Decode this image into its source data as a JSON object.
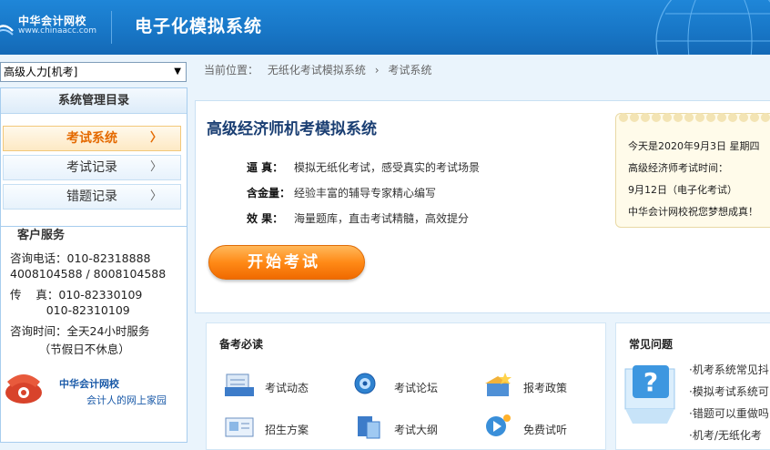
{
  "header": {
    "logo_cn": "中华会计网校",
    "logo_en": "www.chinaacc.com",
    "title": "电子化模拟系统"
  },
  "sidebar": {
    "exam_select": "高级人力[机考]",
    "menu_title": "系统管理目录",
    "items": [
      {
        "label": "考试系统",
        "active": true
      },
      {
        "label": "考试记录",
        "active": false
      },
      {
        "label": "错题记录",
        "active": false
      }
    ],
    "service": {
      "title": "客户服务",
      "lines": [
        "咨询电话：010-82318888",
        "4008104588 / 8008104588",
        "传    真：010-82330109",
        "          010-82310109",
        "咨询时间：全天24小时服务",
        "        （节假日不休息）"
      ],
      "brand": "中华会计网校",
      "slogan": "会计人的网上家园"
    }
  },
  "breadcrumb": {
    "prefix": "当前位置：",
    "items": [
      "无纸化考试模拟系统",
      "›",
      "考试系统"
    ]
  },
  "main": {
    "title": "高级经济师机考模拟系统",
    "features": [
      {
        "key": "逼    真：",
        "text": "模拟无纸化考试，感受真实的考试场景"
      },
      {
        "key": "含金量：",
        "text": "经验丰富的辅导专家精心编写"
      },
      {
        "key": "效    果：",
        "text": "海量题库，直击考试精髓，高效提分"
      }
    ],
    "start_button": "开始考试"
  },
  "notice": {
    "lines": [
      "今天是2020年9月3日 星期四",
      "高级经济师考试时间：",
      "9月12日（电子化考试）",
      "中华会计网校祝您梦想成真！"
    ]
  },
  "prep": {
    "title": "备考必读",
    "items": [
      {
        "label": "考试动态",
        "icon": "news-icon"
      },
      {
        "label": "考试论坛",
        "icon": "forum-icon"
      },
      {
        "label": "报考政策",
        "icon": "policy-icon"
      },
      {
        "label": "招生方案",
        "icon": "enroll-icon"
      },
      {
        "label": "考试大纲",
        "icon": "syllabus-icon"
      },
      {
        "label": "免费试听",
        "icon": "trial-icon"
      }
    ]
  },
  "faq": {
    "title": "常见问题",
    "links": [
      "·机考系统常见抖",
      "·模拟考试系统可",
      "·错题可以重做吗",
      "·机考/无纸化考"
    ]
  },
  "colors": {
    "header_blue": "#1877c7",
    "accent_orange": "#ff8a17",
    "title_blue": "#1b3f73"
  }
}
